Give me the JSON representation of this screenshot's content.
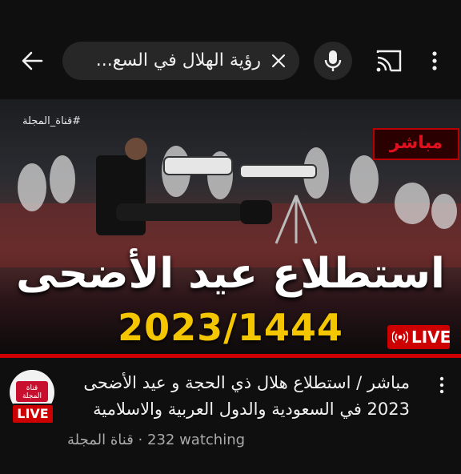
{
  "header": {
    "search_query": "رؤية الهلال في السع...",
    "back_icon": "back-arrow-icon",
    "clear_icon": "close-icon",
    "mic_icon": "mic-icon",
    "cast_icon": "cast-icon",
    "more_icon": "more-vert-icon"
  },
  "thumbnail": {
    "channel_watermark": "#قناة_المجلة",
    "live_label_ar": "مباشر",
    "headline": "استطلاع عيد الأضحى",
    "year": "2023/1444",
    "live_badge": "LIVE",
    "colors": {
      "live_red": "#cc0000",
      "year_yellow": "#f3c600"
    }
  },
  "video": {
    "title": "مباشر / استطلاع هلال ذي الحجة و عيد الأضحى 2023 في السعودية والدول العربية والاسلامية",
    "channel": "قناة المجلة",
    "separator": "·",
    "watching": "232 watching",
    "avatar_live": "LIVE",
    "avatar_logo_text": "قناة المجلة"
  }
}
